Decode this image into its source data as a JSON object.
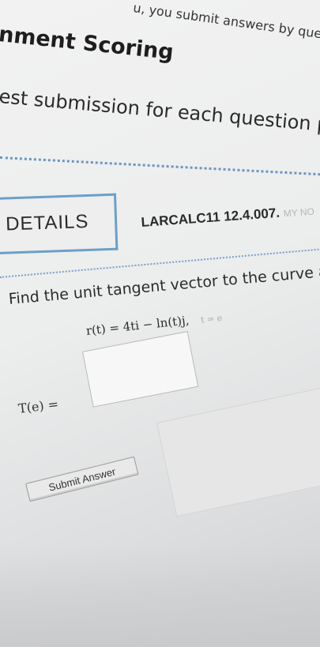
{
  "header": {
    "submit_note": "u, you submit answers by questi",
    "section_title": "nment Scoring",
    "scoring_text": "est submission for each question part is used"
  },
  "question": {
    "details_label": "DETAILS",
    "code": "LARCALC11 12.4.007.",
    "code_tail": "MY NO",
    "prompt": "Find the unit tangent vector to the curve at the spec",
    "function": "r(t) = 4ti − ln(t)j,",
    "function_note": "t = e",
    "answer_label": "T(e) =",
    "answer_value": "",
    "submit_label": "Submit Answer"
  }
}
